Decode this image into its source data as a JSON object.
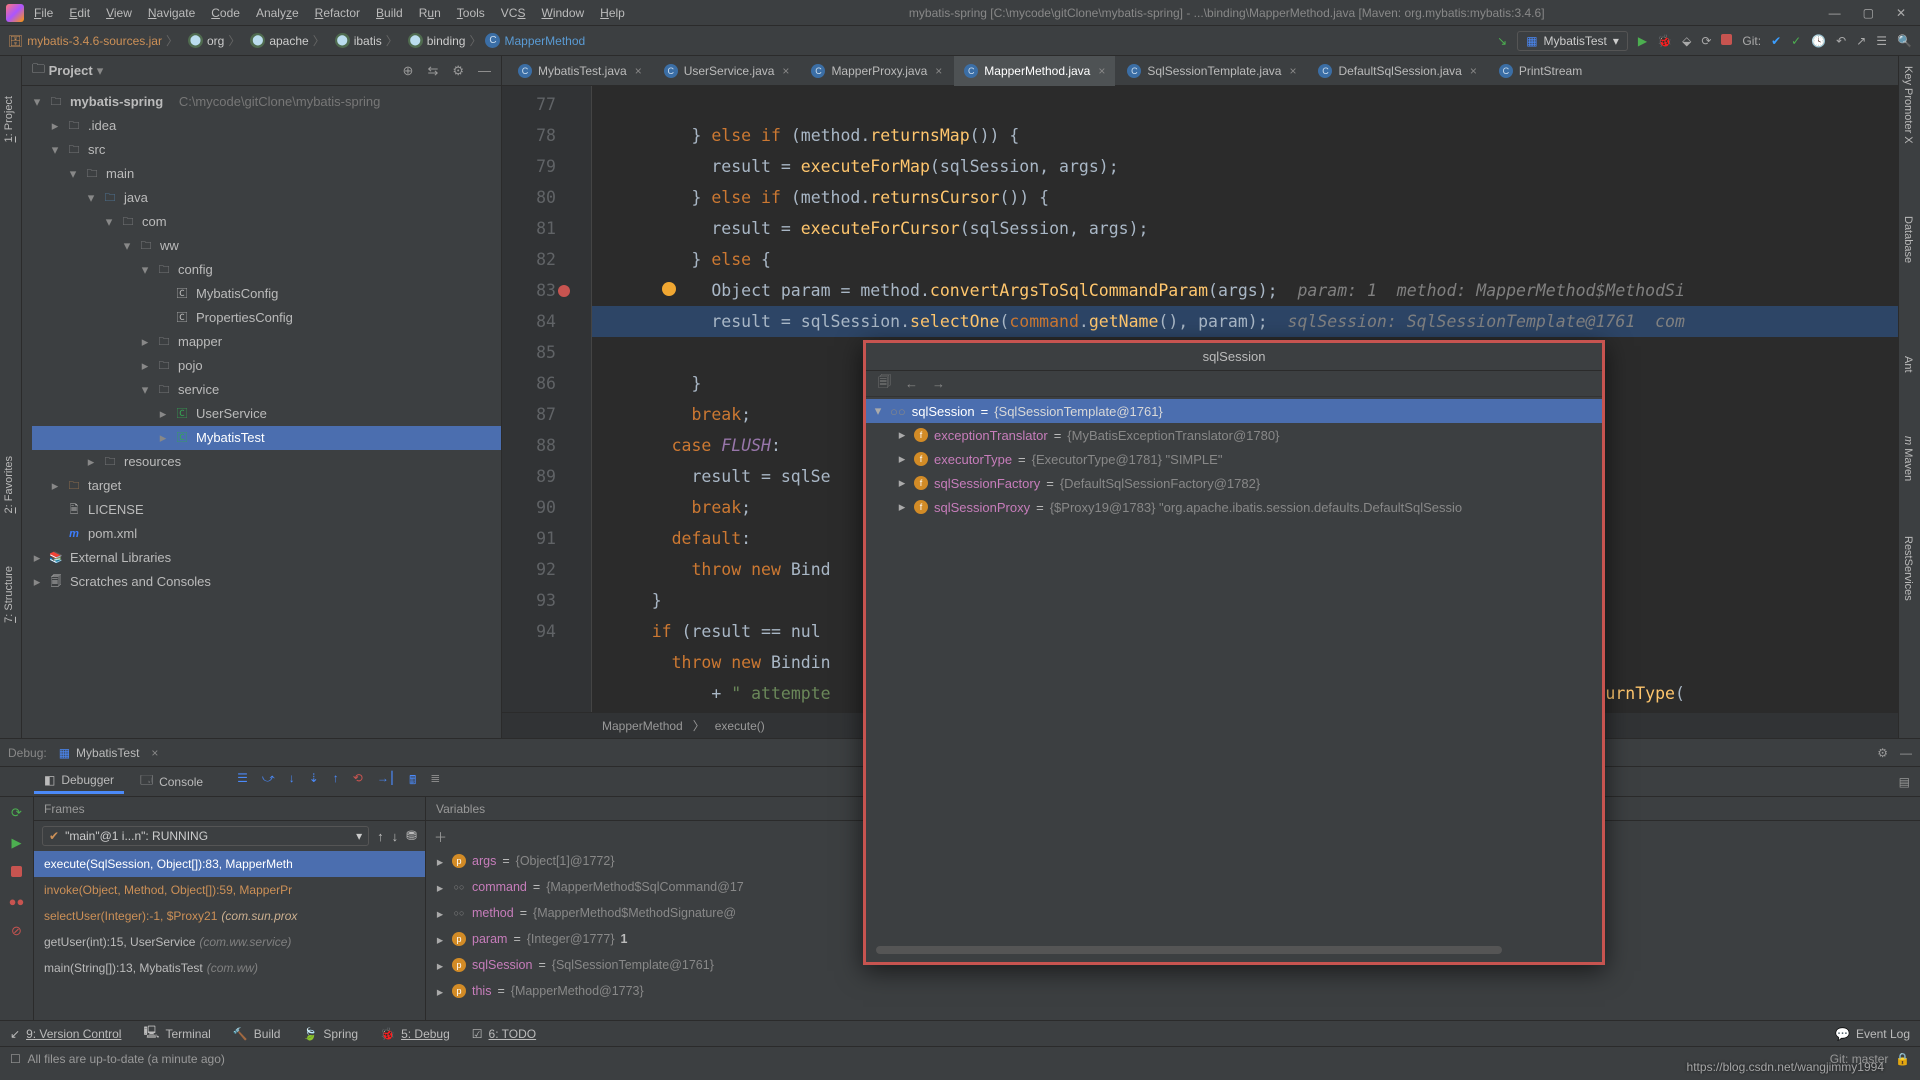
{
  "title": "mybatis-spring [C:\\mycode\\gitClone\\mybatis-spring] - ...\\binding\\MapperMethod.java [Maven: org.mybatis:mybatis:3.4.6]",
  "menu": [
    "File",
    "Edit",
    "View",
    "Navigate",
    "Code",
    "Analyze",
    "Refactor",
    "Build",
    "Run",
    "Tools",
    "VCS",
    "Window",
    "Help"
  ],
  "breadcrumbs": {
    "jar": "mybatis-3.4.6-sources.jar",
    "parts": [
      "org",
      "apache",
      "ibatis",
      "binding"
    ],
    "class": "MapperMethod"
  },
  "runConfig": "MybatisTest",
  "git_label": "Git:",
  "project": {
    "title": "Project",
    "root": "mybatis-spring",
    "rootPath": "C:\\mycode\\gitClone\\mybatis-spring",
    "tree": {
      "idea": ".idea",
      "src": "src",
      "main": "main",
      "java": "java",
      "com": "com",
      "ww": "ww",
      "config": "config",
      "cfg1": "MybatisConfig",
      "cfg2": "PropertiesConfig",
      "mapper": "mapper",
      "pojo": "pojo",
      "service": "service",
      "svc1": "UserService",
      "svc2": "MybatisTest",
      "resources": "resources",
      "target": "target",
      "license": "LICENSE",
      "pom": "pom.xml",
      "extlib": "External Libraries",
      "scratch": "Scratches and Consoles"
    }
  },
  "tabs": [
    "MybatisTest.java",
    "UserService.java",
    "MapperProxy.java",
    "MapperMethod.java",
    "SqlSessionTemplate.java",
    "DefaultSqlSession.java",
    "PrintStream"
  ],
  "activeTab": 3,
  "code": {
    "start": 77,
    "lines": [
      "        } else if (method.returnsMap()) {",
      "          result = executeForMap(sqlSession, args);",
      "        } else if (method.returnsCursor()) {",
      "          result = executeForCursor(sqlSession, args);",
      "        } else {",
      "          Object param = method.convertArgsToSqlCommandParam(args);  param: 1  method: MapperMethod$MethodSi",
      "          result = sqlSession.selectOne(command.getName(), param);  sqlSession: SqlSessionTemplate@1761  com",
      "        }",
      "        break;",
      "      case FLUSH:",
      "        result = sqlSe",
      "        break;",
      "      default:",
      "        throw new Bind                                                             ame());",
      "    }",
      "    if (result == nul                                                             oid()) {",
      "      throw new Bindin",
      "          + \" attempte                                                             \" + method.getReturnType("
    ],
    "current": 83,
    "crumb1": "MapperMethod",
    "crumb2": "execute()"
  },
  "popup": {
    "title": "sqlSession",
    "root": "sqlSession",
    "rootVal": "{SqlSessionTemplate@1761}",
    "items": [
      {
        "name": "exceptionTranslator",
        "val": "{MyBatisExceptionTranslator@1780}"
      },
      {
        "name": "executorType",
        "val": "{ExecutorType@1781} \"SIMPLE\""
      },
      {
        "name": "sqlSessionFactory",
        "val": "{DefaultSqlSessionFactory@1782}"
      },
      {
        "name": "sqlSessionProxy",
        "val": "{$Proxy19@1783} \"org.apache.ibatis.session.defaults.DefaultSqlSessio"
      }
    ]
  },
  "debug": {
    "label": "Debug:",
    "config": "MybatisTest",
    "tabs": {
      "debugger": "Debugger",
      "console": "Console"
    },
    "frames_title": "Frames",
    "vars_title": "Variables",
    "thread": "\"main\"@1 i...n\": RUNNING",
    "frames": [
      {
        "txt": "execute(SqlSession, Object[]):83, MapperMeth",
        "sel": true
      },
      {
        "txt": "invoke(Object, Method, Object[]):59, MapperPr",
        "dim": true
      },
      {
        "txt": "selectUser(Integer):-1, $Proxy21",
        "tail": "(com.sun.prox",
        "dim": true
      },
      {
        "txt": "getUser(int):15, UserService",
        "tail": "(com.ww.service)"
      },
      {
        "txt": "main(String[]):13, MybatisTest",
        "tail": "(com.ww)"
      }
    ],
    "vars": [
      {
        "ic": "p",
        "name": "args",
        "val": "{Object[1]@1772}"
      },
      {
        "ic": "o",
        "name": "command",
        "val": "{MapperMethod$SqlCommand@17"
      },
      {
        "ic": "o",
        "name": "method",
        "val": "{MapperMethod$MethodSignature@"
      },
      {
        "ic": "p",
        "name": "param",
        "val": "{Integer@1777}",
        "extra": " 1"
      },
      {
        "ic": "p",
        "name": "sqlSession",
        "val": "{SqlSessionTemplate@1761}"
      },
      {
        "ic": "p",
        "name": "this",
        "val": "{MapperMethod@1773}"
      }
    ]
  },
  "bottomTabs": {
    "vc": "9: Version Control",
    "term": "Terminal",
    "build": "Build",
    "spring": "Spring",
    "debug": "5: Debug",
    "todo": "6: TODO",
    "eventlog": "Event Log"
  },
  "status": "All files are up-to-date (a minute ago)",
  "gitBranch": "Git: master",
  "watermark": "https://blog.csdn.net/wangjimmy1994"
}
